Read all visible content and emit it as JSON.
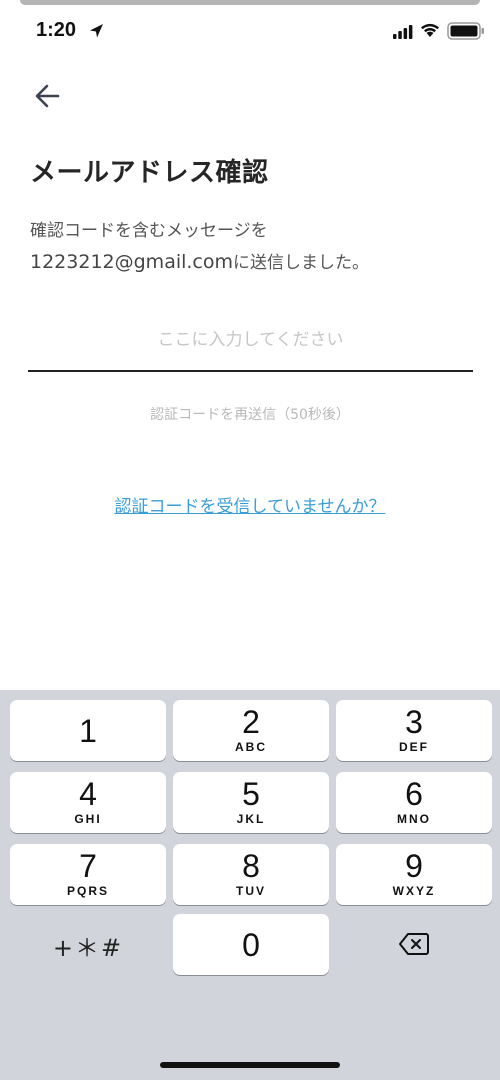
{
  "status_bar": {
    "time": "1:20"
  },
  "header": {
    "title": "メールアドレス確認"
  },
  "description": {
    "line1": "確認コードを含むメッセージを",
    "email": "1223212@gmail.com",
    "line2_suffix": "に送信しました。"
  },
  "code_input": {
    "placeholder": "ここに入力してください",
    "value": ""
  },
  "resend_text": "認証コードを再送信（50秒後）",
  "not_received_link": "認証コードを受信していませんか？",
  "keypad": {
    "keys": [
      {
        "num": "1",
        "letters": ""
      },
      {
        "num": "2",
        "letters": "ABC"
      },
      {
        "num": "3",
        "letters": "DEF"
      },
      {
        "num": "4",
        "letters": "GHI"
      },
      {
        "num": "5",
        "letters": "JKL"
      },
      {
        "num": "6",
        "letters": "MNO"
      },
      {
        "num": "7",
        "letters": "PQRS"
      },
      {
        "num": "8",
        "letters": "TUV"
      },
      {
        "num": "9",
        "letters": "WXYZ"
      },
      {
        "num": "0",
        "letters": ""
      }
    ],
    "symbols_label": "+＊#"
  },
  "icons": {
    "location": "location-arrow-icon",
    "signal": "cellular-signal-icon",
    "wifi": "wifi-icon",
    "battery": "battery-icon",
    "back": "arrow-left-icon",
    "delete": "backspace-icon"
  },
  "colors": {
    "link": "#3a9dd5",
    "keyboard_bg": "#d1d5db",
    "accent_text": "#262626"
  }
}
